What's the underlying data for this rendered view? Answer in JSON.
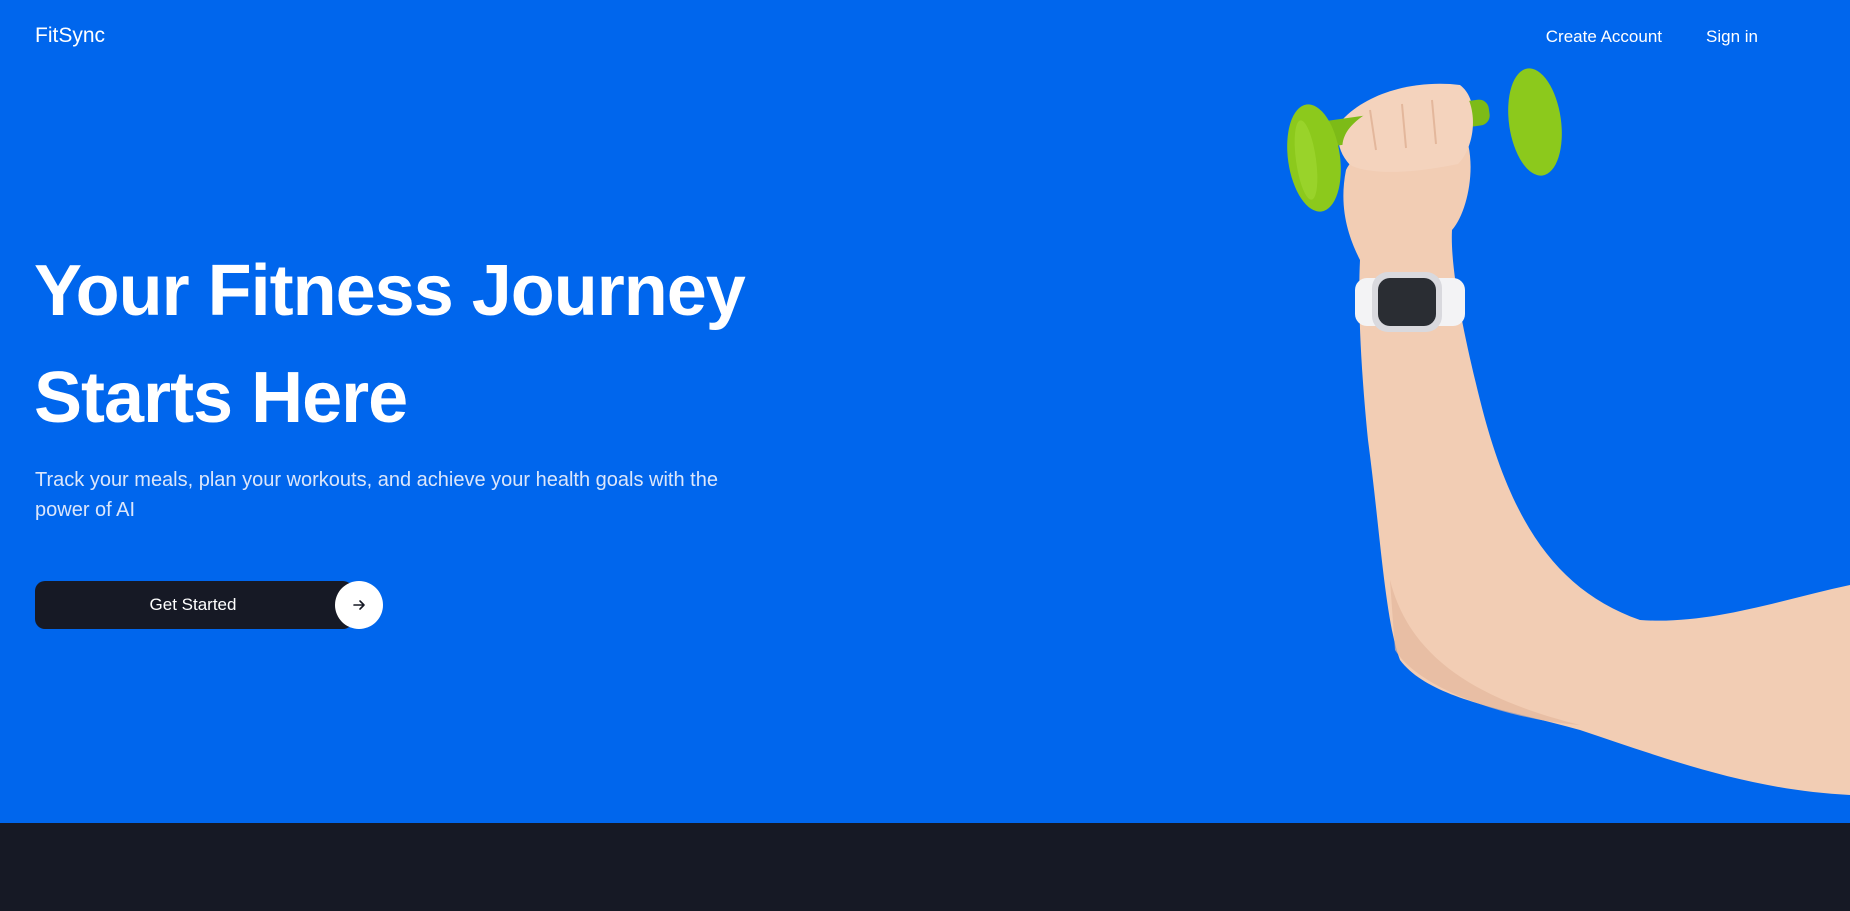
{
  "nav": {
    "logo": "FitSync",
    "create_account": "Create Account",
    "sign_in": "Sign in"
  },
  "hero": {
    "headline_line1": "Your Fitness Journey",
    "headline_line2": "Starts Here",
    "subtitle": "Track your meals, plan your workouts, and achieve your health goals with the power of AI",
    "cta_label": "Get Started",
    "cta_icon": "arrow-right-icon",
    "image": "arm-holding-dumbbell-with-smartwatch"
  },
  "next_section": {
    "heading": ""
  },
  "colors": {
    "hero_background": "#0066ED",
    "dark_background": "#161925",
    "dumbbell": "#8CC91C",
    "button_dark": "#161925"
  }
}
